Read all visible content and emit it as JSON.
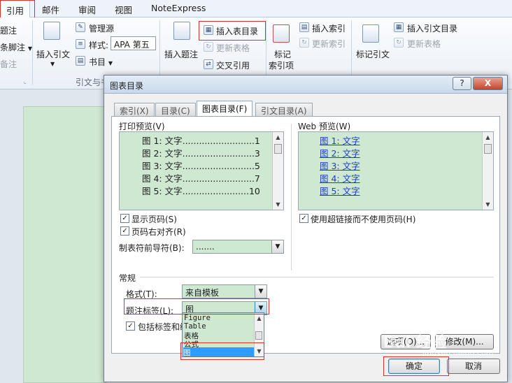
{
  "ribbon": {
    "tabs": [
      "引用",
      "邮件",
      "审阅",
      "视图",
      "NoteExpress"
    ],
    "footnote_group": {
      "insert_footnote": "题注",
      "next_footnote": "条脚注",
      "show_notes": "备注"
    },
    "citation_group": {
      "insert_citation": "插入引文",
      "manage_sources": "管理源",
      "style_label": "样式:",
      "style_value": "APA 第五",
      "bibliography": "书目",
      "group_label": "引文与书"
    },
    "caption_group": {
      "insert_caption": "插入题注",
      "insert_table_of_figures": "插入表目录",
      "update_table": "更新表格",
      "cross_reference": "交叉引用"
    },
    "index_group": {
      "mark_entry": "标记",
      "mark_entry2": "索引项",
      "insert_index": "插入索引",
      "update_index": "更新索引"
    },
    "toa_group": {
      "mark_citation": "标记引文",
      "insert_toa": "插入引文目录",
      "update_table": "更新表格"
    }
  },
  "dialog": {
    "title": "图表目录",
    "help": "?",
    "close": "X",
    "tabs": [
      "索引(X)",
      "目录(C)",
      "图表目录(F)",
      "引文目录(A)"
    ],
    "print_preview_label": "打印预览(V)",
    "print_entries": [
      "图 1: 文字..........................1",
      "图 2: 文字..........................3",
      "图 3: 文字..........................5",
      "图 4: 文字..........................7",
      "图 5: 文字........................10"
    ],
    "web_preview_label": "Web 预览(W)",
    "web_entries": [
      "图 1: 文字",
      "图 2: 文字",
      "图 3: 文字",
      "图 4: 文字",
      "图 5: 文字"
    ],
    "show_page_numbers": "显示页码(S)",
    "right_align": "页码右对齐(R)",
    "tab_leader_label": "制表符前导符(B):",
    "tab_leader_value": ".......",
    "use_hyperlinks": "使用超链接而不使用页码(H)",
    "general_label": "常规",
    "format_label": "格式(T):",
    "format_value": "来自模板",
    "caption_label_label": "题注标签(L):",
    "caption_label_value": "图",
    "include_label": "包括标签和编",
    "caption_options": [
      "Figure",
      "Table",
      "表格",
      "公式",
      "图"
    ],
    "options_button": "选项(O)...",
    "modify_button": "修改(M)...",
    "ok_button": "确定",
    "cancel_button": "取消"
  },
  "watermark": {
    "brand": "Bai 经验",
    "sub": "jingyan.baidu.com"
  }
}
